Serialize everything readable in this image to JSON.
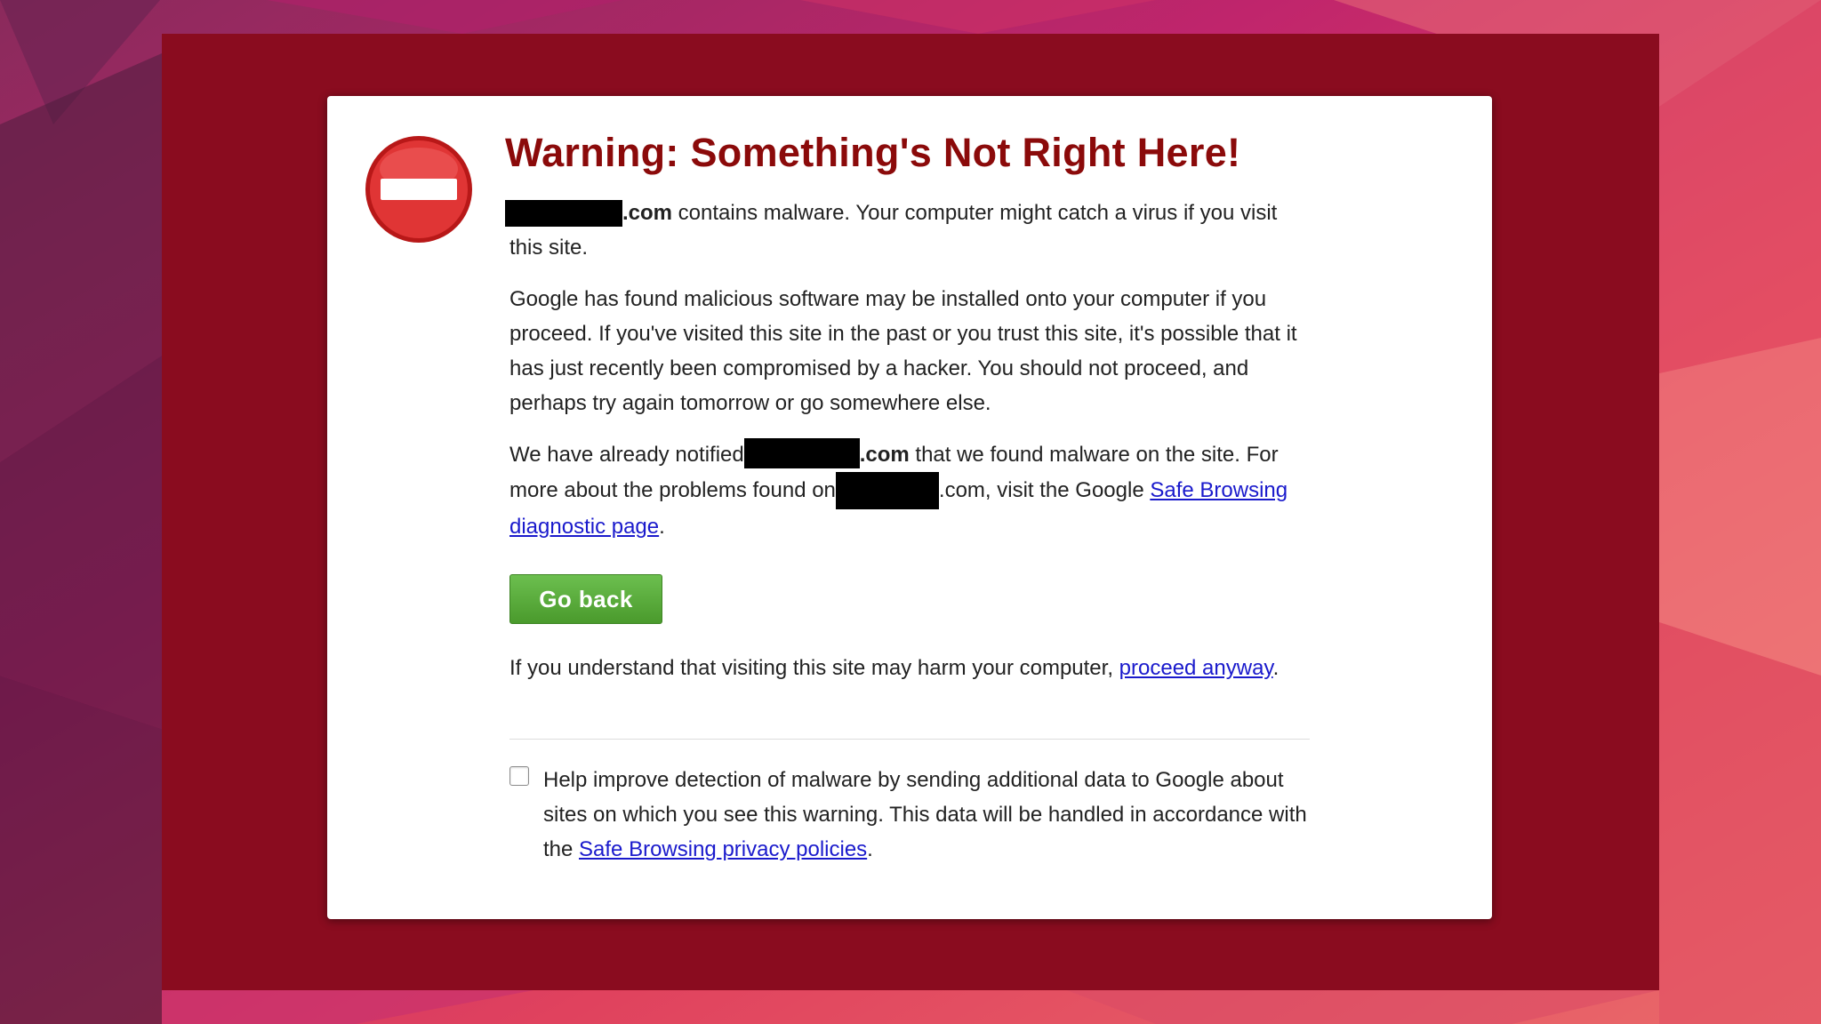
{
  "colors": {
    "frame": "#8a0c1f",
    "title": "#8b0a0a",
    "button": "#52a535",
    "link": "#1a1acc"
  },
  "warning": {
    "icon": "stop-icon",
    "title": "Warning: Something's Not Right Here!",
    "para1": {
      "domain_suffix": ".com",
      "text": " contains malware. Your computer might catch a virus if you visit this site."
    },
    "para2": "Google has found malicious software may be installed onto your computer if you proceed. If you've visited this site in the past or you trust this site, it's possible that it has just recently been compromised by a hacker. You should not proceed, and perhaps try again tomorrow or go somewhere else.",
    "para3": {
      "prefix": "We have already notified",
      "domain_suffix": ".com",
      "middle": " that we found malware on the site. For more about the problems found on",
      "domain_suffix2": ".com, visit the Google ",
      "link": "Safe Browsing diagnostic page",
      "end": "."
    },
    "go_back_label": "Go back",
    "proceed": {
      "text": "If you understand that visiting this site may harm your computer, ",
      "link": "proceed anyway",
      "end": "."
    },
    "report": {
      "text": "Help improve detection of malware by sending additional data to Google about sites on which you see this warning. This data will be handled in accordance with the ",
      "link": "Safe Browsing privacy policies",
      "end": "."
    }
  }
}
